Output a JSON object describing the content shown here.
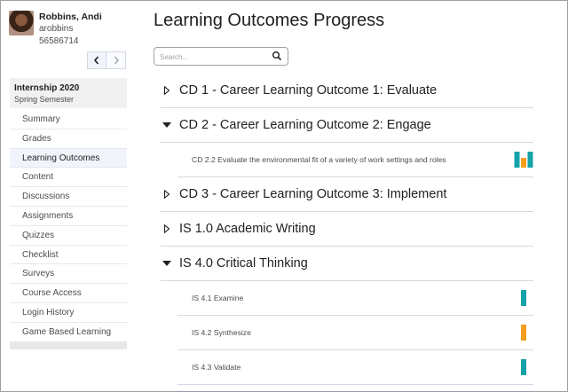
{
  "user": {
    "name": "Robbins, Andi",
    "username": "arobbins",
    "id": "56586714"
  },
  "course": {
    "title": "Internship 2020",
    "term": "Spring Semester"
  },
  "nav": [
    {
      "label": "Summary"
    },
    {
      "label": "Grades"
    },
    {
      "label": "Learning Outcomes",
      "active": true
    },
    {
      "label": "Content"
    },
    {
      "label": "Discussions"
    },
    {
      "label": "Assignments"
    },
    {
      "label": "Quizzes"
    },
    {
      "label": "Checklist"
    },
    {
      "label": "Surveys"
    },
    {
      "label": "Course Access"
    },
    {
      "label": "Login History"
    },
    {
      "label": "Game Based Learning"
    }
  ],
  "page": {
    "title": "Learning Outcomes Progress",
    "search_placeholder": "Search..."
  },
  "colors": {
    "teal": "#14a3a8",
    "orange": "#f59d1d"
  },
  "outcomes": [
    {
      "title": "CD 1 - Career Learning Outcome 1: Evaluate",
      "expanded": false,
      "children": []
    },
    {
      "title": "CD 2 - Career Learning Outcome 2: Engage",
      "expanded": true,
      "children": [
        {
          "label": "CD 2.2 Evaluate the environmental fit of a variety of work settings and roles",
          "marks": [
            "teal",
            "orange",
            "teal"
          ]
        }
      ]
    },
    {
      "title": "CD 3 - Career Learning Outcome 3: Implement",
      "expanded": false,
      "children": []
    },
    {
      "title": "IS 1.0 Academic Writing",
      "expanded": false,
      "children": []
    },
    {
      "title": "IS 4.0 Critical Thinking",
      "expanded": true,
      "children": [
        {
          "label": "IS 4.1 Examine",
          "marks": [
            "teal"
          ]
        },
        {
          "label": "IS 4.2 Synthesize",
          "marks": [
            "orange"
          ]
        },
        {
          "label": "IS 4.3 Validate",
          "marks": [
            "teal"
          ]
        }
      ]
    }
  ]
}
